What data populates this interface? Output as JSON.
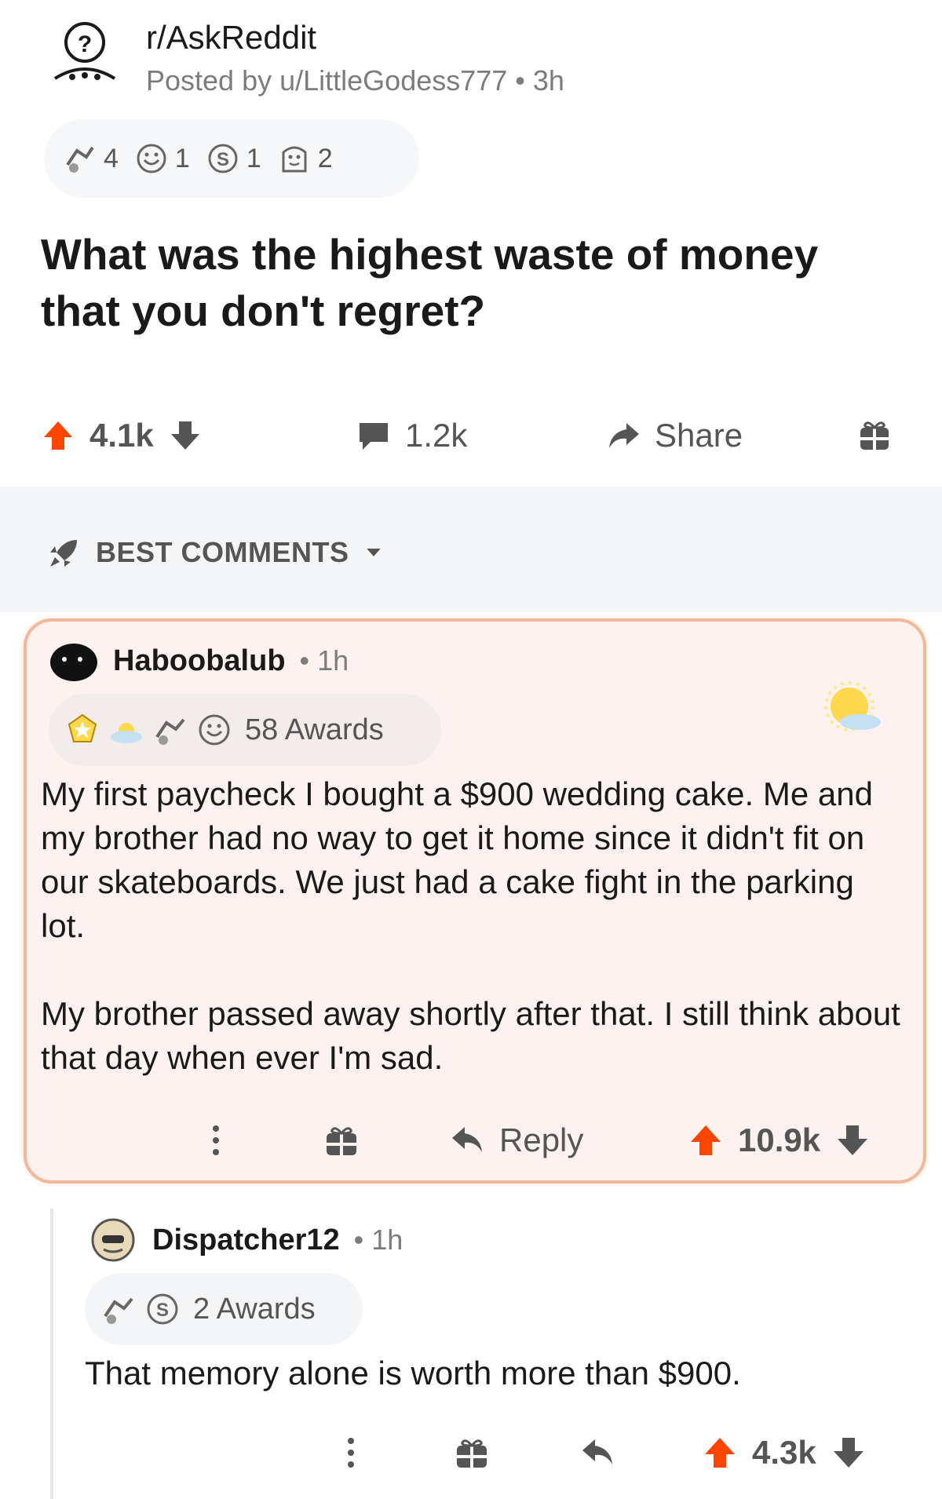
{
  "post": {
    "subreddit": "r/AskReddit",
    "posted_by": "Posted by u/LittleGodess777 • 3h",
    "awards": [
      {
        "icon": "helpful-award-icon",
        "count": "4"
      },
      {
        "icon": "wholesome-award-icon",
        "count": "1"
      },
      {
        "icon": "silver-award-icon",
        "count": "1"
      },
      {
        "icon": "hugz-award-icon",
        "count": "2"
      }
    ],
    "title": "What was the highest waste of money that you don't regret?",
    "upvotes": "4.1k",
    "comments": "1.2k",
    "share_label": "Share"
  },
  "sort": {
    "label": "BEST COMMENTS"
  },
  "comment1": {
    "user": "Haboobalub",
    "time": "• 1h",
    "awards_label": "58 Awards",
    "paragraphs": [
      "My first paycheck I bought a $900 wedding cake. Me and my brother had no way to get it home since it didn't fit on our skateboards. We just had a cake fight in the parking lot.",
      "My brother passed away shortly after that. I still think about that day when ever I'm sad."
    ],
    "reply_label": "Reply",
    "score": "10.9k"
  },
  "comment2": {
    "user": "Dispatcher12",
    "time": "• 1h",
    "awards_label": "2 Awards",
    "text": "That memory alone is worth more than $900.",
    "score": "4.3k"
  },
  "colors": {
    "upvote": "#ff4500",
    "accent_border": "#f2b89a",
    "highlight_bg": "#fdf2ef",
    "muted_text": "#7c7c7c"
  }
}
